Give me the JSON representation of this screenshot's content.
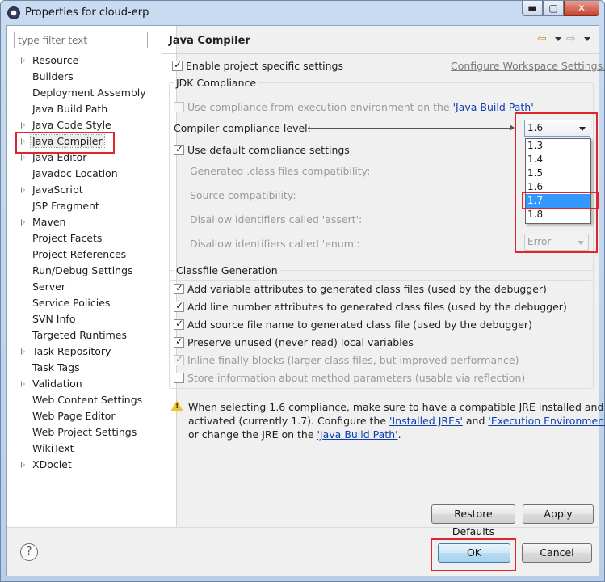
{
  "window": {
    "title": "Properties for cloud-erp",
    "buttons": {
      "minimize": "▬",
      "maximize": "▢",
      "close": "✕"
    }
  },
  "filter": {
    "placeholder": "type filter text"
  },
  "tree": {
    "items": [
      {
        "label": "Resource",
        "expandable": true
      },
      {
        "label": "Builders",
        "expandable": false
      },
      {
        "label": "Deployment Assembly",
        "expandable": false
      },
      {
        "label": "Java Build Path",
        "expandable": false
      },
      {
        "label": "Java Code Style",
        "expandable": true
      },
      {
        "label": "Java Compiler",
        "expandable": true,
        "selected": true
      },
      {
        "label": "Java Editor",
        "expandable": true
      },
      {
        "label": "Javadoc Location",
        "expandable": false
      },
      {
        "label": "JavaScript",
        "expandable": true
      },
      {
        "label": "JSP Fragment",
        "expandable": false
      },
      {
        "label": "Maven",
        "expandable": true
      },
      {
        "label": "Project Facets",
        "expandable": false
      },
      {
        "label": "Project References",
        "expandable": false
      },
      {
        "label": "Run/Debug Settings",
        "expandable": false
      },
      {
        "label": "Server",
        "expandable": false
      },
      {
        "label": "Service Policies",
        "expandable": false
      },
      {
        "label": "SVN Info",
        "expandable": false
      },
      {
        "label": "Targeted Runtimes",
        "expandable": false
      },
      {
        "label": "Task Repository",
        "expandable": true
      },
      {
        "label": "Task Tags",
        "expandable": false
      },
      {
        "label": "Validation",
        "expandable": true
      },
      {
        "label": "Web Content Settings",
        "expandable": false
      },
      {
        "label": "Web Page Editor",
        "expandable": false
      },
      {
        "label": "Web Project Settings",
        "expandable": false
      },
      {
        "label": "WikiText",
        "expandable": false
      },
      {
        "label": "XDoclet",
        "expandable": true
      }
    ]
  },
  "page": {
    "title": "Java Compiler",
    "enable_project_settings": "Enable project specific settings",
    "configure_workspace": "Configure Workspace Settings...",
    "jdk": {
      "legend": "JDK Compliance",
      "use_exec_env_prefix": "Use compliance from execution environment on the ",
      "use_exec_env_link": "'Java Build Path'",
      "compliance_label": "Compiler compliance level:",
      "compliance_value": "1.6",
      "compliance_options": [
        "1.3",
        "1.4",
        "1.5",
        "1.6",
        "1.7",
        "1.8"
      ],
      "highlighted_option": "1.7",
      "use_default": "Use default compliance settings",
      "generated_class": "Generated .class files compatibility:",
      "source_compat": "Source compatibility:",
      "disallow_assert": "Disallow identifiers called 'assert':",
      "disallow_enum": "Disallow identifiers called 'enum':",
      "disallow_enum_value": "Error"
    },
    "classfile": {
      "legend": "Classfile Generation",
      "opt1": "Add variable attributes to generated class files (used by the debugger)",
      "opt2": "Add line number attributes to generated class files (used by the debugger)",
      "opt3": "Add source file name to generated class file (used by the debugger)",
      "opt4": "Preserve unused (never read) local variables",
      "opt5": "Inline finally blocks (larger class files, but improved performance)",
      "opt6": "Store information about method parameters (usable via reflection)"
    },
    "warning": {
      "line1": "When selecting 1.6 compliance, make sure to have a compatible JRE installed and",
      "line2_prefix": "activated (currently 1.7). Configure the ",
      "link_jres": "'Installed JREs'",
      "and": " and ",
      "link_env": "'Execution Environments'",
      "comma": ",",
      "line3_prefix": "or change the JRE on the ",
      "link_build_path": "'Java Build Path'",
      "period": "."
    },
    "restore_defaults": "Restore Defaults",
    "apply": "Apply"
  },
  "footer": {
    "help": "?",
    "ok": "OK",
    "cancel": "Cancel"
  },
  "colors": {
    "annotation_red": "#e0242d",
    "link_blue": "#0b3fae",
    "highlight": "#3399ff"
  }
}
